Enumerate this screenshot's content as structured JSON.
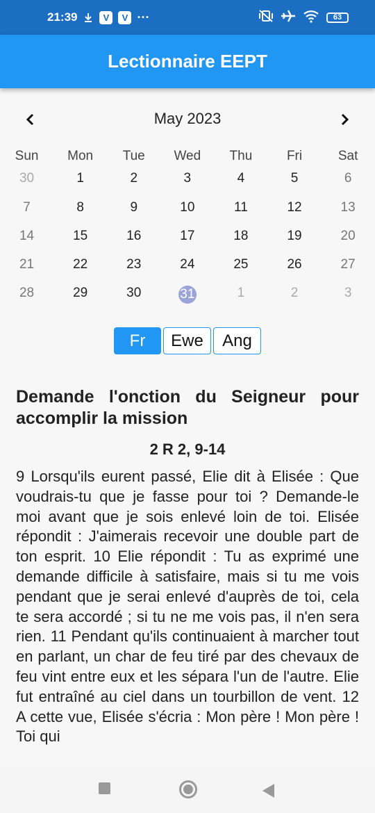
{
  "status_bar": {
    "time": "21:39",
    "icons": [
      "download-icon",
      "v-app-icon",
      "v-app-icon",
      "more-dots-icon",
      "vibrate-off-icon",
      "airplane-icon",
      "wifi-icon"
    ],
    "badge_v": "V",
    "dots": "···",
    "battery": "63"
  },
  "app_bar": {
    "title": "Lectionnaire EEPT",
    "color": "#2196f3"
  },
  "calendar": {
    "month_label": "May 2023",
    "prev_icon": "chevron-left-icon",
    "next_icon": "chevron-right-icon",
    "weekdays": [
      "Sun",
      "Mon",
      "Tue",
      "Wed",
      "Thu",
      "Fri",
      "Sat"
    ],
    "weeks": [
      [
        "30",
        "1",
        "2",
        "3",
        "4",
        "5",
        "6"
      ],
      [
        "7",
        "8",
        "9",
        "10",
        "11",
        "12",
        "13"
      ],
      [
        "14",
        "15",
        "16",
        "17",
        "18",
        "19",
        "20"
      ],
      [
        "21",
        "22",
        "23",
        "24",
        "25",
        "26",
        "27"
      ],
      [
        "28",
        "29",
        "30",
        "31",
        "1",
        "2",
        "3"
      ]
    ],
    "selected_day": "31",
    "selected_color": "#9aa4d9"
  },
  "languages": {
    "items": [
      "Fr",
      "Ewe",
      "Ang"
    ],
    "selected": "Fr"
  },
  "reading": {
    "heading": "Demande l'onction du Seigneur pour accomplir la mission",
    "reference": "2 R 2, 9-14",
    "text": "9 Lorsqu'ils eurent passé, Elie dit à Elisée : Que voudrais-tu que je fasse pour toi ? Demande-le moi avant que je sois enlevé loin de toi. Elisée répondit : J'aimerais recevoir une double part de ton esprit. 10 Elie répondit : Tu as exprimé une demande difficile à satisfaire, mais si tu me vois pendant que je serai enlevé d'auprès de toi, cela te sera accordé ; si tu ne me vois pas, il n'en sera rien. 11 Pendant qu'ils continuaient à marcher tout en parlant, un char de feu tiré par des chevaux de feu vint entre eux et les sépara l'un de l'autre. Elie fut entraîné au ciel dans un tourbillon de vent. 12 A cette vue, Elisée s'écria : Mon père ! Mon père ! Toi qui"
  },
  "nav_bar": {
    "buttons": [
      "recents-square-icon",
      "home-circle-icon",
      "back-triangle-icon"
    ]
  }
}
